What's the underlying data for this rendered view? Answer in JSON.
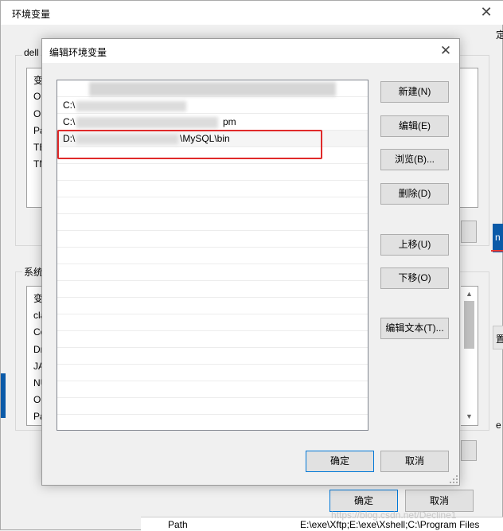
{
  "outer": {
    "title": "环境变量",
    "close_glyph": "✕",
    "user_group_label": "dell",
    "system_group_label": "系统",
    "user_rows": [
      "变",
      "On",
      "On",
      "Pa",
      "TE",
      "TM"
    ],
    "system_rows": [
      "变",
      "cla",
      "Co",
      "Dr",
      "JA",
      "NU",
      "OS",
      "Pa"
    ],
    "ok_label": "确定",
    "cancel_label": "取消",
    "side_labels": [
      "定",
      "n",
      "置",
      "e"
    ],
    "bottom_cell": "Path",
    "bottom_value": "E:\\exe\\Xftp;E:\\exe\\Xshell;C:\\Program Files"
  },
  "inner": {
    "title": "编辑环境变量",
    "close_glyph": "✕",
    "paths": [
      {
        "text": ""
      },
      {
        "text": "C:\\"
      },
      {
        "text": "C:\\",
        "suffix": "pm"
      },
      {
        "text": "D:\\",
        "suffix": "\\MySQL\\bin"
      }
    ],
    "buttons": {
      "new": "新建(N)",
      "edit": "编辑(E)",
      "browse": "浏览(B)...",
      "delete": "删除(D)",
      "move_up": "上移(U)",
      "move_down": "下移(O)",
      "edit_text": "编辑文本(T)..."
    },
    "ok_label": "确定",
    "cancel_label": "取消"
  },
  "watermark": "https://blog.csdn.net/Decline1"
}
